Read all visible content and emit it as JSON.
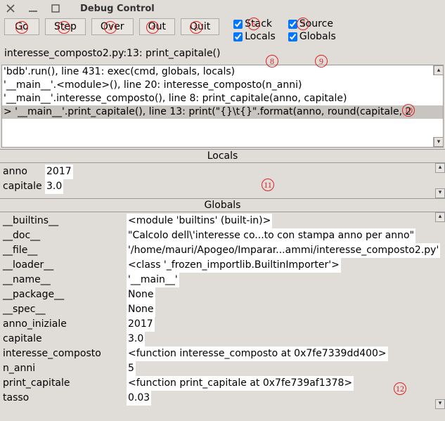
{
  "window": {
    "title": "Debug Control"
  },
  "toolbar": {
    "go": "Go",
    "step": "Step",
    "over": "Over",
    "out": "Out",
    "quit": "Quit"
  },
  "checks": {
    "stack": "Stack",
    "source": "Source",
    "locals": "Locals",
    "globals": "Globals"
  },
  "status": "interesse_composto2.py:13: print_capitale()",
  "stack": {
    "l0": "'bdb'.run(), line 431: exec(cmd, globals, locals)",
    "l1": "'__main__'.<module>(), line 20: interesse_composto(n_anni)",
    "l2": "'__main__'.interesse_composto(), line 8: print_capitale(anno, capitale)",
    "l3": "> '__main__'.print_capitale(), line 13: print(\"{}\\t{}\".format(anno, round(capitale, 2"
  },
  "section": {
    "locals": "Locals",
    "globals": "Globals"
  },
  "locals": [
    {
      "name": "anno",
      "value": "2017"
    },
    {
      "name": "capitale",
      "value": "3.0"
    }
  ],
  "globals": [
    {
      "name": "__builtins__",
      "value": "<module 'builtins' (built-in)>"
    },
    {
      "name": "__doc__",
      "value": "\"Calcolo dell\\'interesse co...to con stampa anno per anno\""
    },
    {
      "name": "__file__",
      "value": "'/home/mauri/Apogeo/Imparar...ammi/interesse_composto2.py'"
    },
    {
      "name": "__loader__",
      "value": "<class '_frozen_importlib.BuiltinImporter'>"
    },
    {
      "name": "__name__",
      "value": "'__main__'"
    },
    {
      "name": "__package__",
      "value": "None"
    },
    {
      "name": "__spec__",
      "value": "None"
    },
    {
      "name": "anno_iniziale",
      "value": "2017"
    },
    {
      "name": "capitale",
      "value": "3.0"
    },
    {
      "name": "interesse_composto",
      "value": "<function interesse_composto at 0x7fe7339dd400>"
    },
    {
      "name": "n_anni",
      "value": "5"
    },
    {
      "name": "print_capitale",
      "value": "<function print_capitale at 0x7fe739af1378>"
    },
    {
      "name": "tasso",
      "value": "0.03"
    }
  ],
  "annotations": [
    "①",
    "②",
    "③",
    "④",
    "⑤",
    "⑥",
    "⑦",
    "⑧",
    "⑨",
    "⑩",
    "⑪",
    "⑫"
  ]
}
